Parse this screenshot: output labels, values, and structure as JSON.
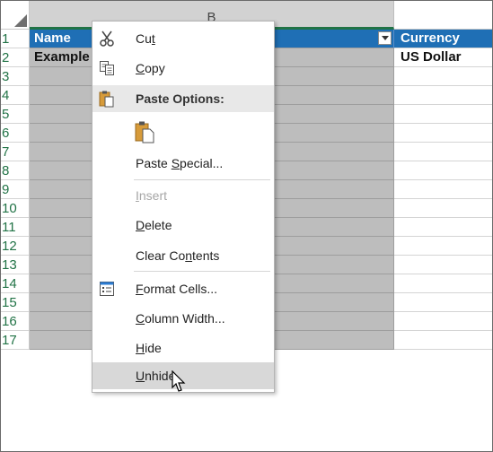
{
  "columns": {
    "b_header": "B"
  },
  "rows": [
    "1",
    "2",
    "3",
    "4",
    "5",
    "6",
    "7",
    "8",
    "9",
    "10",
    "11",
    "12",
    "13",
    "14",
    "15",
    "16",
    "17"
  ],
  "table": {
    "header_name": "Name",
    "header_currency": "Currency",
    "row2_name": "Example",
    "row2_currency": "US Dollar"
  },
  "context_menu": {
    "cut": {
      "pre": "Cu",
      "ul": "t",
      "post": ""
    },
    "copy": {
      "pre": "",
      "ul": "C",
      "post": "opy"
    },
    "paste_options": "Paste Options:",
    "paste_special": {
      "pre": "Paste ",
      "ul": "S",
      "post": "pecial..."
    },
    "insert": {
      "pre": "",
      "ul": "I",
      "post": "nsert"
    },
    "delete": {
      "pre": "",
      "ul": "D",
      "post": "elete"
    },
    "clear_contents": {
      "pre": "Clear Co",
      "ul": "n",
      "post": "tents"
    },
    "format_cells": {
      "pre": "",
      "ul": "F",
      "post": "ormat Cells..."
    },
    "column_width": {
      "pre": "",
      "ul": "C",
      "post": "olumn Width..."
    },
    "hide": {
      "pre": "",
      "ul": "H",
      "post": "ide"
    },
    "unhide": {
      "pre": "",
      "ul": "U",
      "post": "nhide"
    }
  },
  "icons": {
    "cut": "scissors-icon",
    "copy": "copy-icon",
    "paste_options": "clipboard-icon",
    "paste_button": "clipboard-paste-icon",
    "format_cells": "format-cells-icon",
    "cursor": "mouse-pointer-icon"
  },
  "colors": {
    "table_header": "#1f6fb5",
    "selected_column": "#bdbdbd",
    "accent": "#217346",
    "menu_hover": "#d8d8d8",
    "disabled_text": "#a6a6a6"
  }
}
